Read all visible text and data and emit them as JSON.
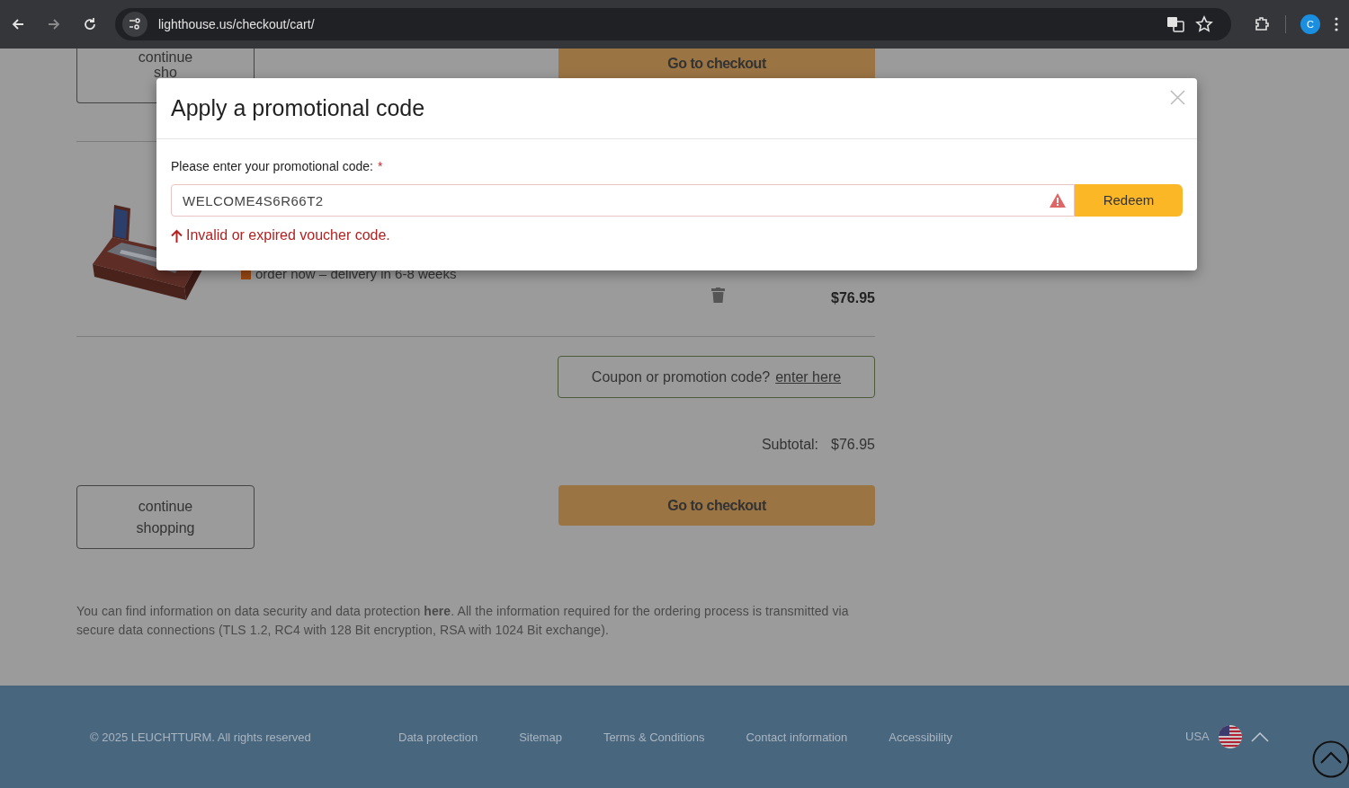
{
  "browser": {
    "url": "lighthouse.us/checkout/cart/",
    "profile_initial": "C"
  },
  "cart": {
    "top_continue": [
      "continue",
      "sho"
    ],
    "top_checkout": "Go to checkout",
    "item": {
      "kind": "picture",
      "availability": "order now – delivery in 6-8 weeks",
      "price": "$76.95"
    },
    "coupon": {
      "prompt": "Coupon or promotion code?",
      "link": "enter here"
    },
    "subtotal": {
      "label": "Subtotal:",
      "value": "$76.95"
    },
    "continue_button": "continue shopping",
    "checkout_button": "Go to checkout",
    "notice": "You can find information on data security and data protection **here**. All the information required for the ordering process is transmitted via secure data connections (TLS 1.2, RC4 with 128 Bit encryption, RSA with 1024 Bit exchange)."
  },
  "footer": {
    "copyright": "© 2025 LEUCHTTURM. All rights reserved",
    "links": [
      "Data protection",
      "Sitemap",
      "Terms & Conditions",
      "Contact information",
      "Accessibility"
    ],
    "country": "USA"
  },
  "modal": {
    "title": "Apply a promotional code",
    "label": "Please enter your promotional code:",
    "required": "*",
    "value": "WELCOME4S6R66T2",
    "invalid": true,
    "button": "Redeem",
    "error": "Invalid or expired voucher code."
  }
}
